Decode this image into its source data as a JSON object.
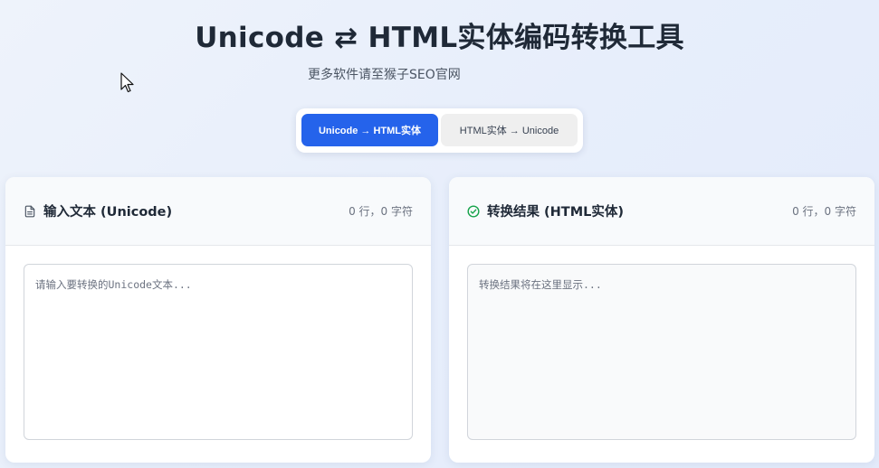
{
  "header": {
    "title": "Unicode ⇄ HTML实体编码转换工具",
    "subtitle": "更多软件请至猴子SEO官网"
  },
  "mode_switch": {
    "options": [
      {
        "label": "Unicode → HTML实体",
        "active": true
      },
      {
        "label": "HTML实体 → Unicode",
        "active": false
      }
    ]
  },
  "input_panel": {
    "icon": "document-icon",
    "title": "输入文本 (Unicode)",
    "count": "0 行，0 字符",
    "placeholder": "请输入要转换的Unicode文本...",
    "value": ""
  },
  "output_panel": {
    "icon": "check-circle-icon",
    "title": "转换结果 (HTML实体)",
    "count": "0 行，0 字符",
    "placeholder": "转换结果将在这里显示...",
    "value": ""
  },
  "colors": {
    "accent": "#2563eb",
    "success": "#16a34a",
    "text": "#1f2937",
    "muted": "#6b7280"
  }
}
